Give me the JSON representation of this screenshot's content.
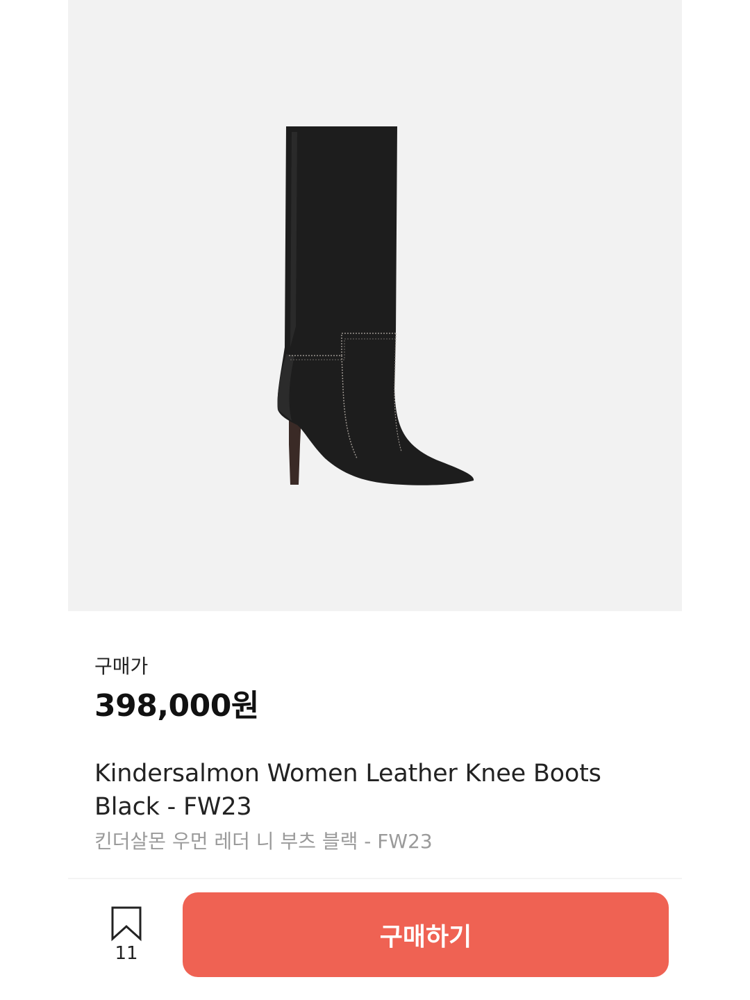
{
  "product": {
    "image_alt": "boot-image",
    "price_label": "구매가",
    "price": "398,000원",
    "name_en": "Kindersalmon Women Leather Knee Boots Black - FW23",
    "name_ko": "킨더살몬 우먼 레더 니 부츠 블랙 - FW23"
  },
  "actions": {
    "bookmark_icon": "bookmark-outline-icon",
    "bookmark_count": "11",
    "buy_label": "구매하기"
  },
  "colors": {
    "accent": "#ef6253",
    "image_bg": "#f2f2f2",
    "secondary_text": "#9a9a9a"
  }
}
